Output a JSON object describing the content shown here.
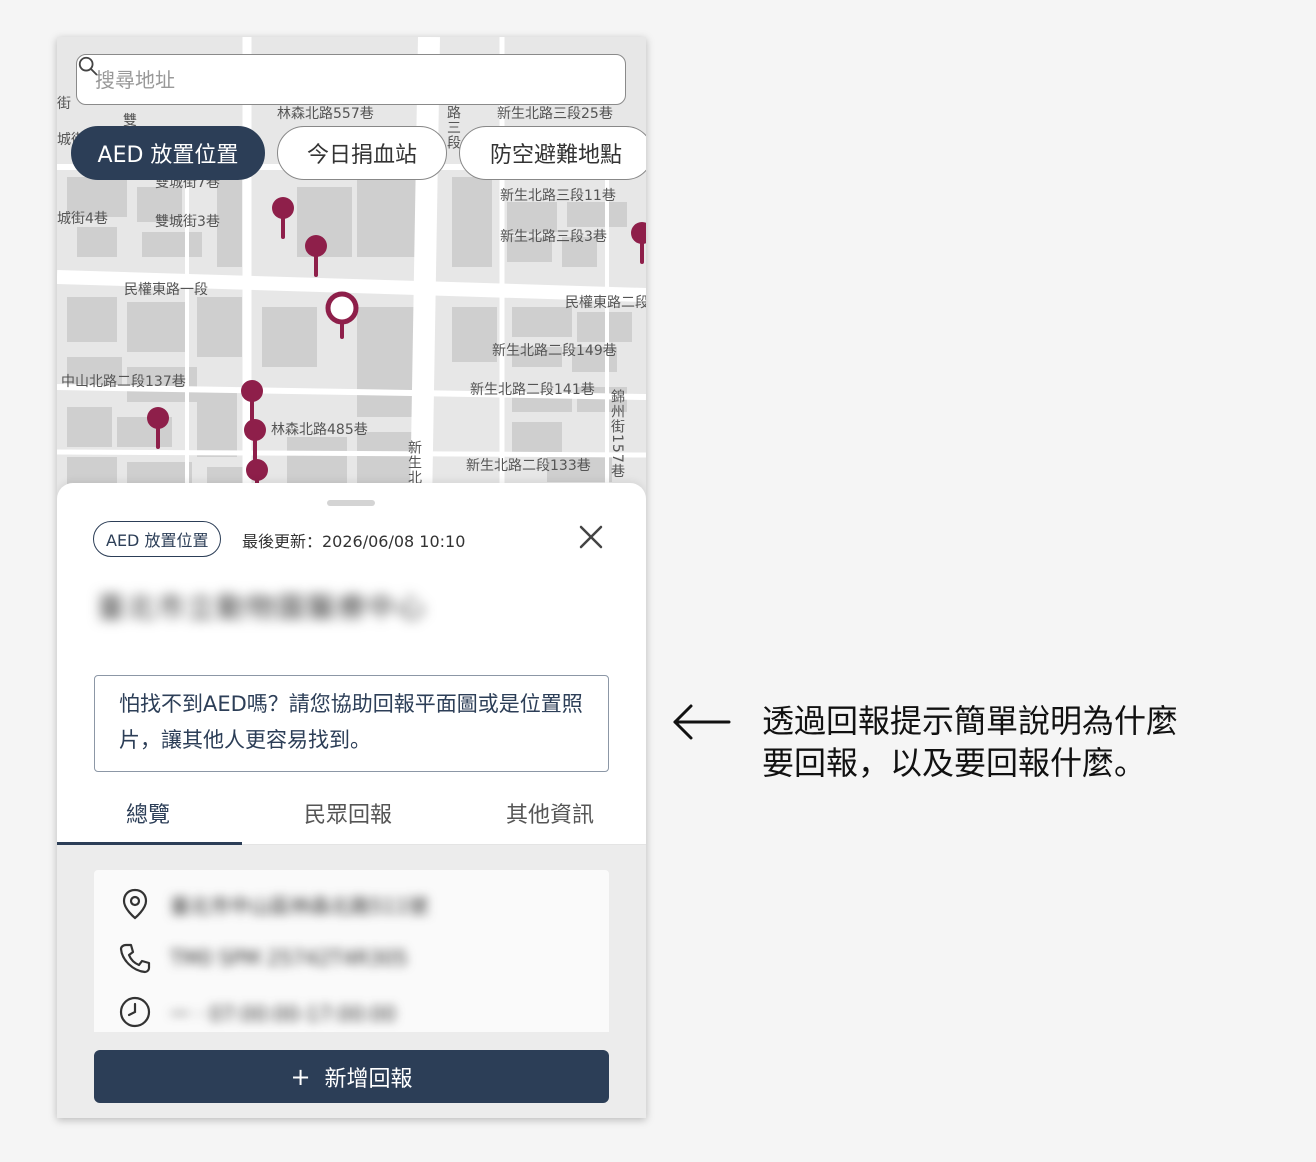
{
  "search": {
    "placeholder": "搜尋地址",
    "value": ""
  },
  "chips": [
    "AED 放置位置",
    "今日捐血站",
    "防空避難地點"
  ],
  "map_streets": {
    "h": [
      "林森北路557巷",
      "新生北路三段25巷",
      "雙城街7巷",
      "雙城街3巷",
      "城街4巷",
      "新生北路三段11巷",
      "新生北路三段3巷",
      "民權東路一段",
      "民權東路二段",
      "新生北路二段149巷",
      "中山北路二段137巷",
      "新生北路二段141巷",
      "林森北路485巷",
      "新生北路二段133巷",
      "雙",
      "街",
      "城街"
    ],
    "v": [
      "錦州街157巷",
      "新生北",
      "路三段"
    ]
  },
  "sheet": {
    "category_tag": "AED 放置位置",
    "updated": "最後更新：2026/06/08 10:10",
    "title": "臺北市立動物園醫療中心",
    "hint": "怕找不到AED嗎？請您協助回報平面圖或是位置照片，讓其他人更容易找到。",
    "tabs": [
      "總覽",
      "民眾回報",
      "其他資訊"
    ],
    "info": {
      "address": "臺北市中山區林森北路511號",
      "phone": "TM0 SPM 25742T4R305",
      "hours": "一 · 07:00:00-17:00:00"
    },
    "add_button": "新增回報"
  },
  "annotation": {
    "line1": "透過回報提示簡單說明為什麼",
    "line2": "要回報，以及要回報什麼。"
  },
  "colors": {
    "primary": "#2c3e57",
    "pin": "#8e1f4a"
  }
}
